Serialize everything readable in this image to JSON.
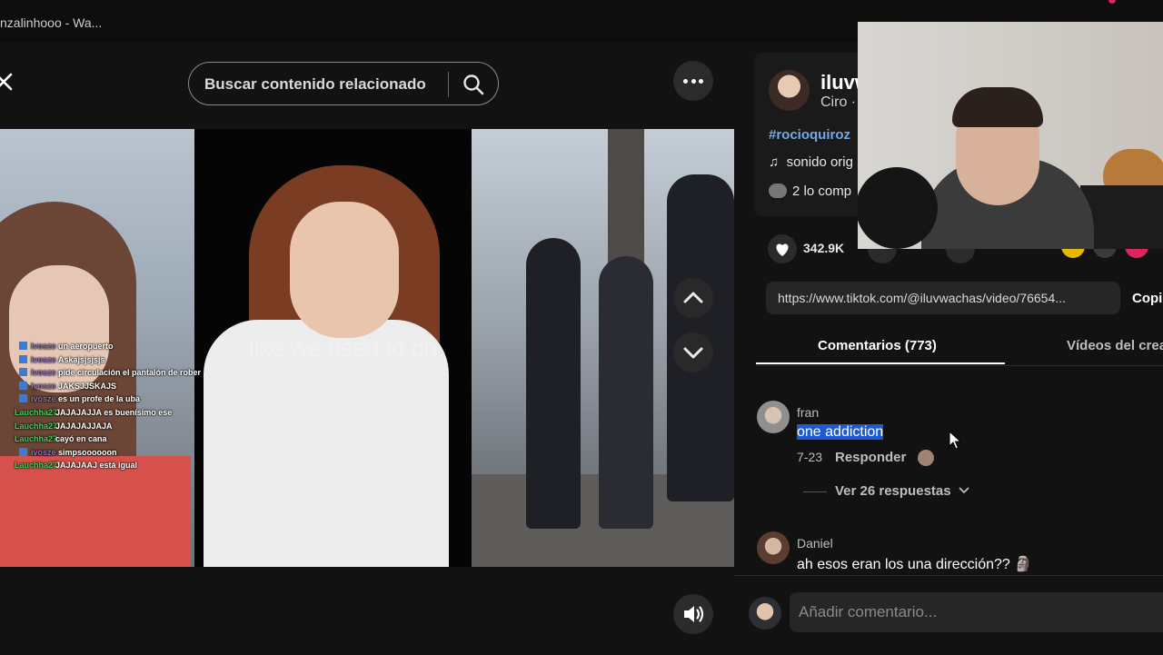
{
  "window": {
    "title": "nzalinhooo - Wa..."
  },
  "player": {
    "search_placeholder": "Buscar contenido relacionado",
    "caption": "like we used to do",
    "chat": [
      {
        "user": "ivosze",
        "text": "un aeropuerto",
        "badge": true,
        "hidden": true
      },
      {
        "user": "ivosze",
        "text": "Askajsjsjsjs",
        "badge": true,
        "hidden": true
      },
      {
        "user": "ivosze",
        "text": "pide circulación el pantalón de rober",
        "badge": true,
        "hidden": true
      },
      {
        "user": "ivosze",
        "text": "JAKSJJSKAJS",
        "badge": true,
        "hidden": true
      },
      {
        "user": "ivosze",
        "text": "es un profe de la uba",
        "badge": true,
        "hidden": true
      },
      {
        "user": "Lauchha27",
        "text": "JAJAJAJJA es buenísimo ese",
        "badge": false,
        "hidden": false
      },
      {
        "user": "Lauchha27",
        "text": "JAJAJAJJAJA",
        "badge": false,
        "hidden": false
      },
      {
        "user": "Lauchha27",
        "text": "cayó en cana",
        "badge": false,
        "hidden": false
      },
      {
        "user": "ivosze",
        "text": "simpsoooooon",
        "badge": true,
        "hidden": true
      },
      {
        "user": "Lauchha27",
        "text": "JAJAJAAJ está igual",
        "badge": false,
        "hidden": false
      }
    ]
  },
  "author": {
    "username": "iluvw",
    "subtitle": "Ciro ·",
    "hashtag": "#rocioquiroz",
    "sound": "sonido orig",
    "shared": "2 lo comp"
  },
  "stats": {
    "likes": "342.9K"
  },
  "share": {
    "url": "https://www.tiktok.com/@iluvwachas/video/76654...",
    "copy_label": "Copi"
  },
  "tabs": {
    "comments": "Comentarios (773)",
    "videos": "Vídeos del crea"
  },
  "comments": [
    {
      "name": "fran",
      "text": "one addiction",
      "date": "7-23",
      "reply_label": "Responder",
      "view_replies": "Ver 26 respuestas"
    },
    {
      "name": "Daniel",
      "text": "ah esos eran los una dirección?? 🗿"
    }
  ],
  "add_comment": {
    "placeholder": "Añadir comentario..."
  },
  "icons": {
    "close": "close-icon",
    "search": "search-icon",
    "more": "more-icon",
    "up": "chevron-up-icon",
    "down": "chevron-down-icon",
    "volume": "volume-icon",
    "music": "music-note-icon",
    "heart": "heart-icon",
    "cursor": "cursor-icon"
  },
  "colors": {
    "background": "#121212",
    "link": "#73a9e6",
    "selection": "#1e5ad6",
    "accent": "#e0245e",
    "chat_user": "#3ad35a"
  }
}
